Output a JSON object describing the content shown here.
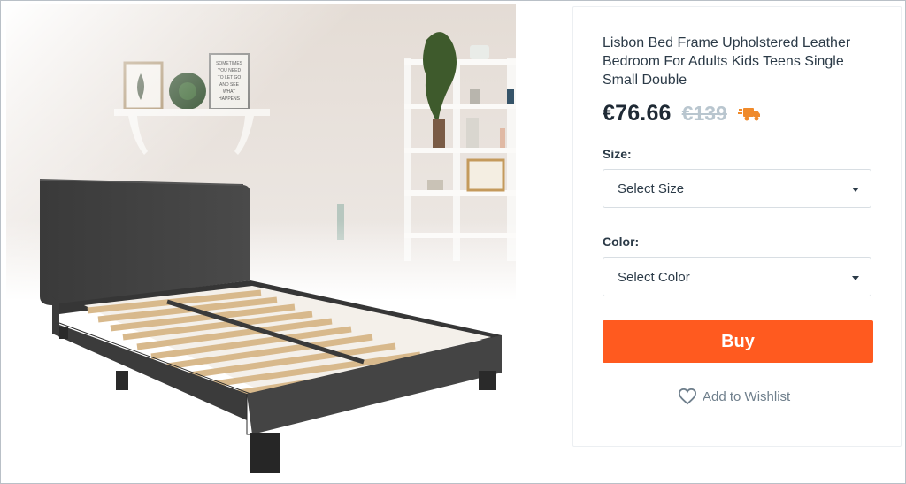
{
  "product": {
    "title": "Lisbon Bed Frame Upholstered Leather Bedroom For Adults Kids Teens Single Small Double",
    "price": "€76.66",
    "old_price": "€139",
    "image_sign_text": "SOMETIMES YOU NEED TO LET GO AND SEE WHAT HAPPENS"
  },
  "size": {
    "label": "Size:",
    "value": "Select Size"
  },
  "color": {
    "label": "Color:",
    "value": "Select Color"
  },
  "actions": {
    "buy": "Buy",
    "wishlist": "Add to Wishlist"
  },
  "icons": {
    "shipping": "truck-icon",
    "wishlist": "heart-icon",
    "dropdown": "caret-down-icon"
  },
  "colors": {
    "accent": "#ff5a1f",
    "truck": "#f08a2a",
    "text": "#2b3a47",
    "muted": "#b9c6cf"
  }
}
